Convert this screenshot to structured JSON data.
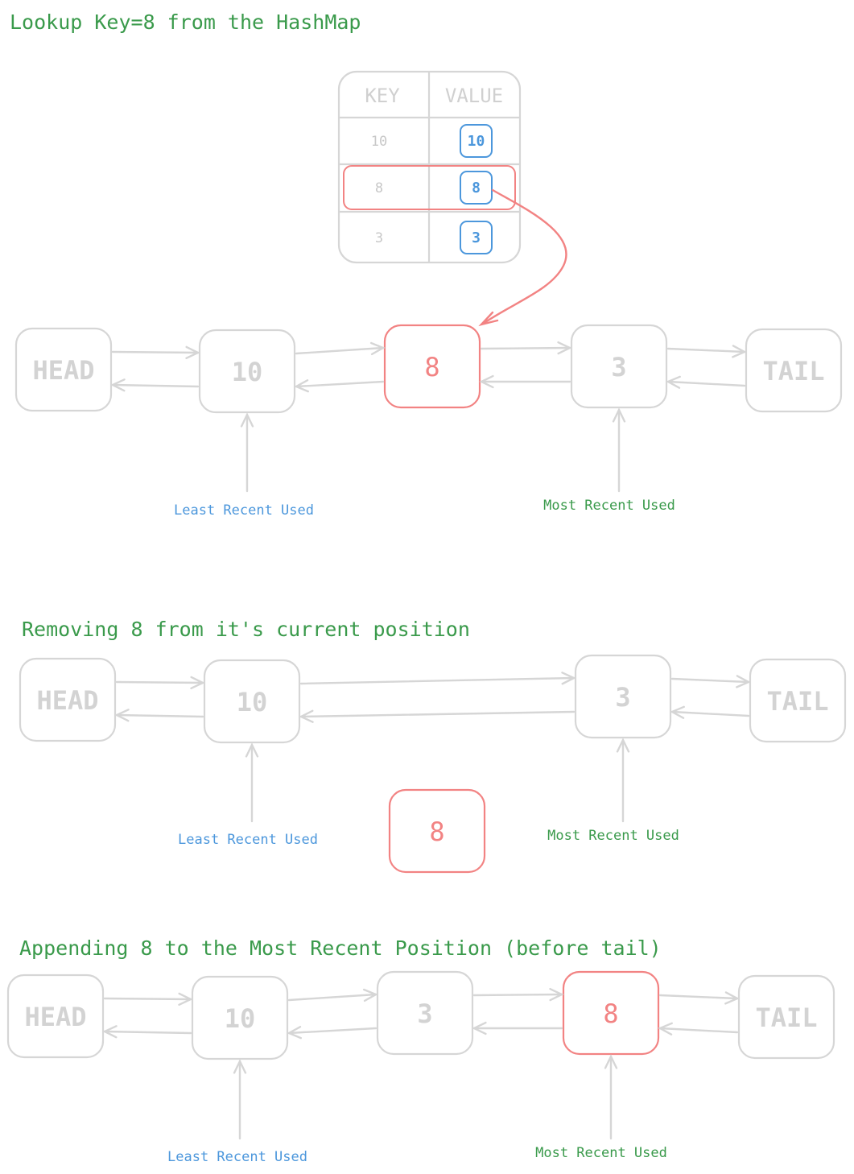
{
  "colors": {
    "title": "#3a9a4b",
    "node": "#d6d6d6",
    "node_text": "#d3d3d3",
    "highlight": "#f28383",
    "lru_label": "#4c97dc",
    "mru_label": "#3a9a4b",
    "value_box": "#4c97dc"
  },
  "sections": [
    {
      "title": "Lookup Key=8 from the HashMap",
      "nodes": [
        {
          "label": "HEAD",
          "highlight": false
        },
        {
          "label": "10",
          "highlight": false
        },
        {
          "label": "8",
          "highlight": true
        },
        {
          "label": "3",
          "highlight": false
        },
        {
          "label": "TAIL",
          "highlight": false
        }
      ],
      "lru_label": "Least Recent Used",
      "lru_node": 1,
      "mru_label": "Most Recent Used",
      "mru_node": 3
    },
    {
      "title": "Removing 8 from it's current position",
      "nodes": [
        {
          "label": "HEAD",
          "highlight": false
        },
        {
          "label": "10",
          "highlight": false
        },
        {
          "label": "3",
          "highlight": false
        },
        {
          "label": "TAIL",
          "highlight": false
        }
      ],
      "detached_node": {
        "label": "8",
        "highlight": true
      },
      "lru_label": "Least Recent Used",
      "lru_node": 1,
      "mru_label": "Most Recent Used",
      "mru_node": 2
    },
    {
      "title": "Appending 8 to the Most Recent Position (before tail)",
      "nodes": [
        {
          "label": "HEAD",
          "highlight": false
        },
        {
          "label": "10",
          "highlight": false
        },
        {
          "label": "3",
          "highlight": false
        },
        {
          "label": "8",
          "highlight": true
        },
        {
          "label": "TAIL",
          "highlight": false
        }
      ],
      "lru_label": "Least Recent Used",
      "lru_node": 1,
      "mru_label": "Most Recent Used",
      "mru_node": 3
    }
  ],
  "hashmap": {
    "headers": [
      "KEY",
      "VALUE"
    ],
    "rows": [
      {
        "key": "10",
        "value": "10",
        "highlight": false
      },
      {
        "key": "8",
        "value": "8",
        "highlight": true
      },
      {
        "key": "3",
        "value": "3",
        "highlight": false
      }
    ]
  }
}
